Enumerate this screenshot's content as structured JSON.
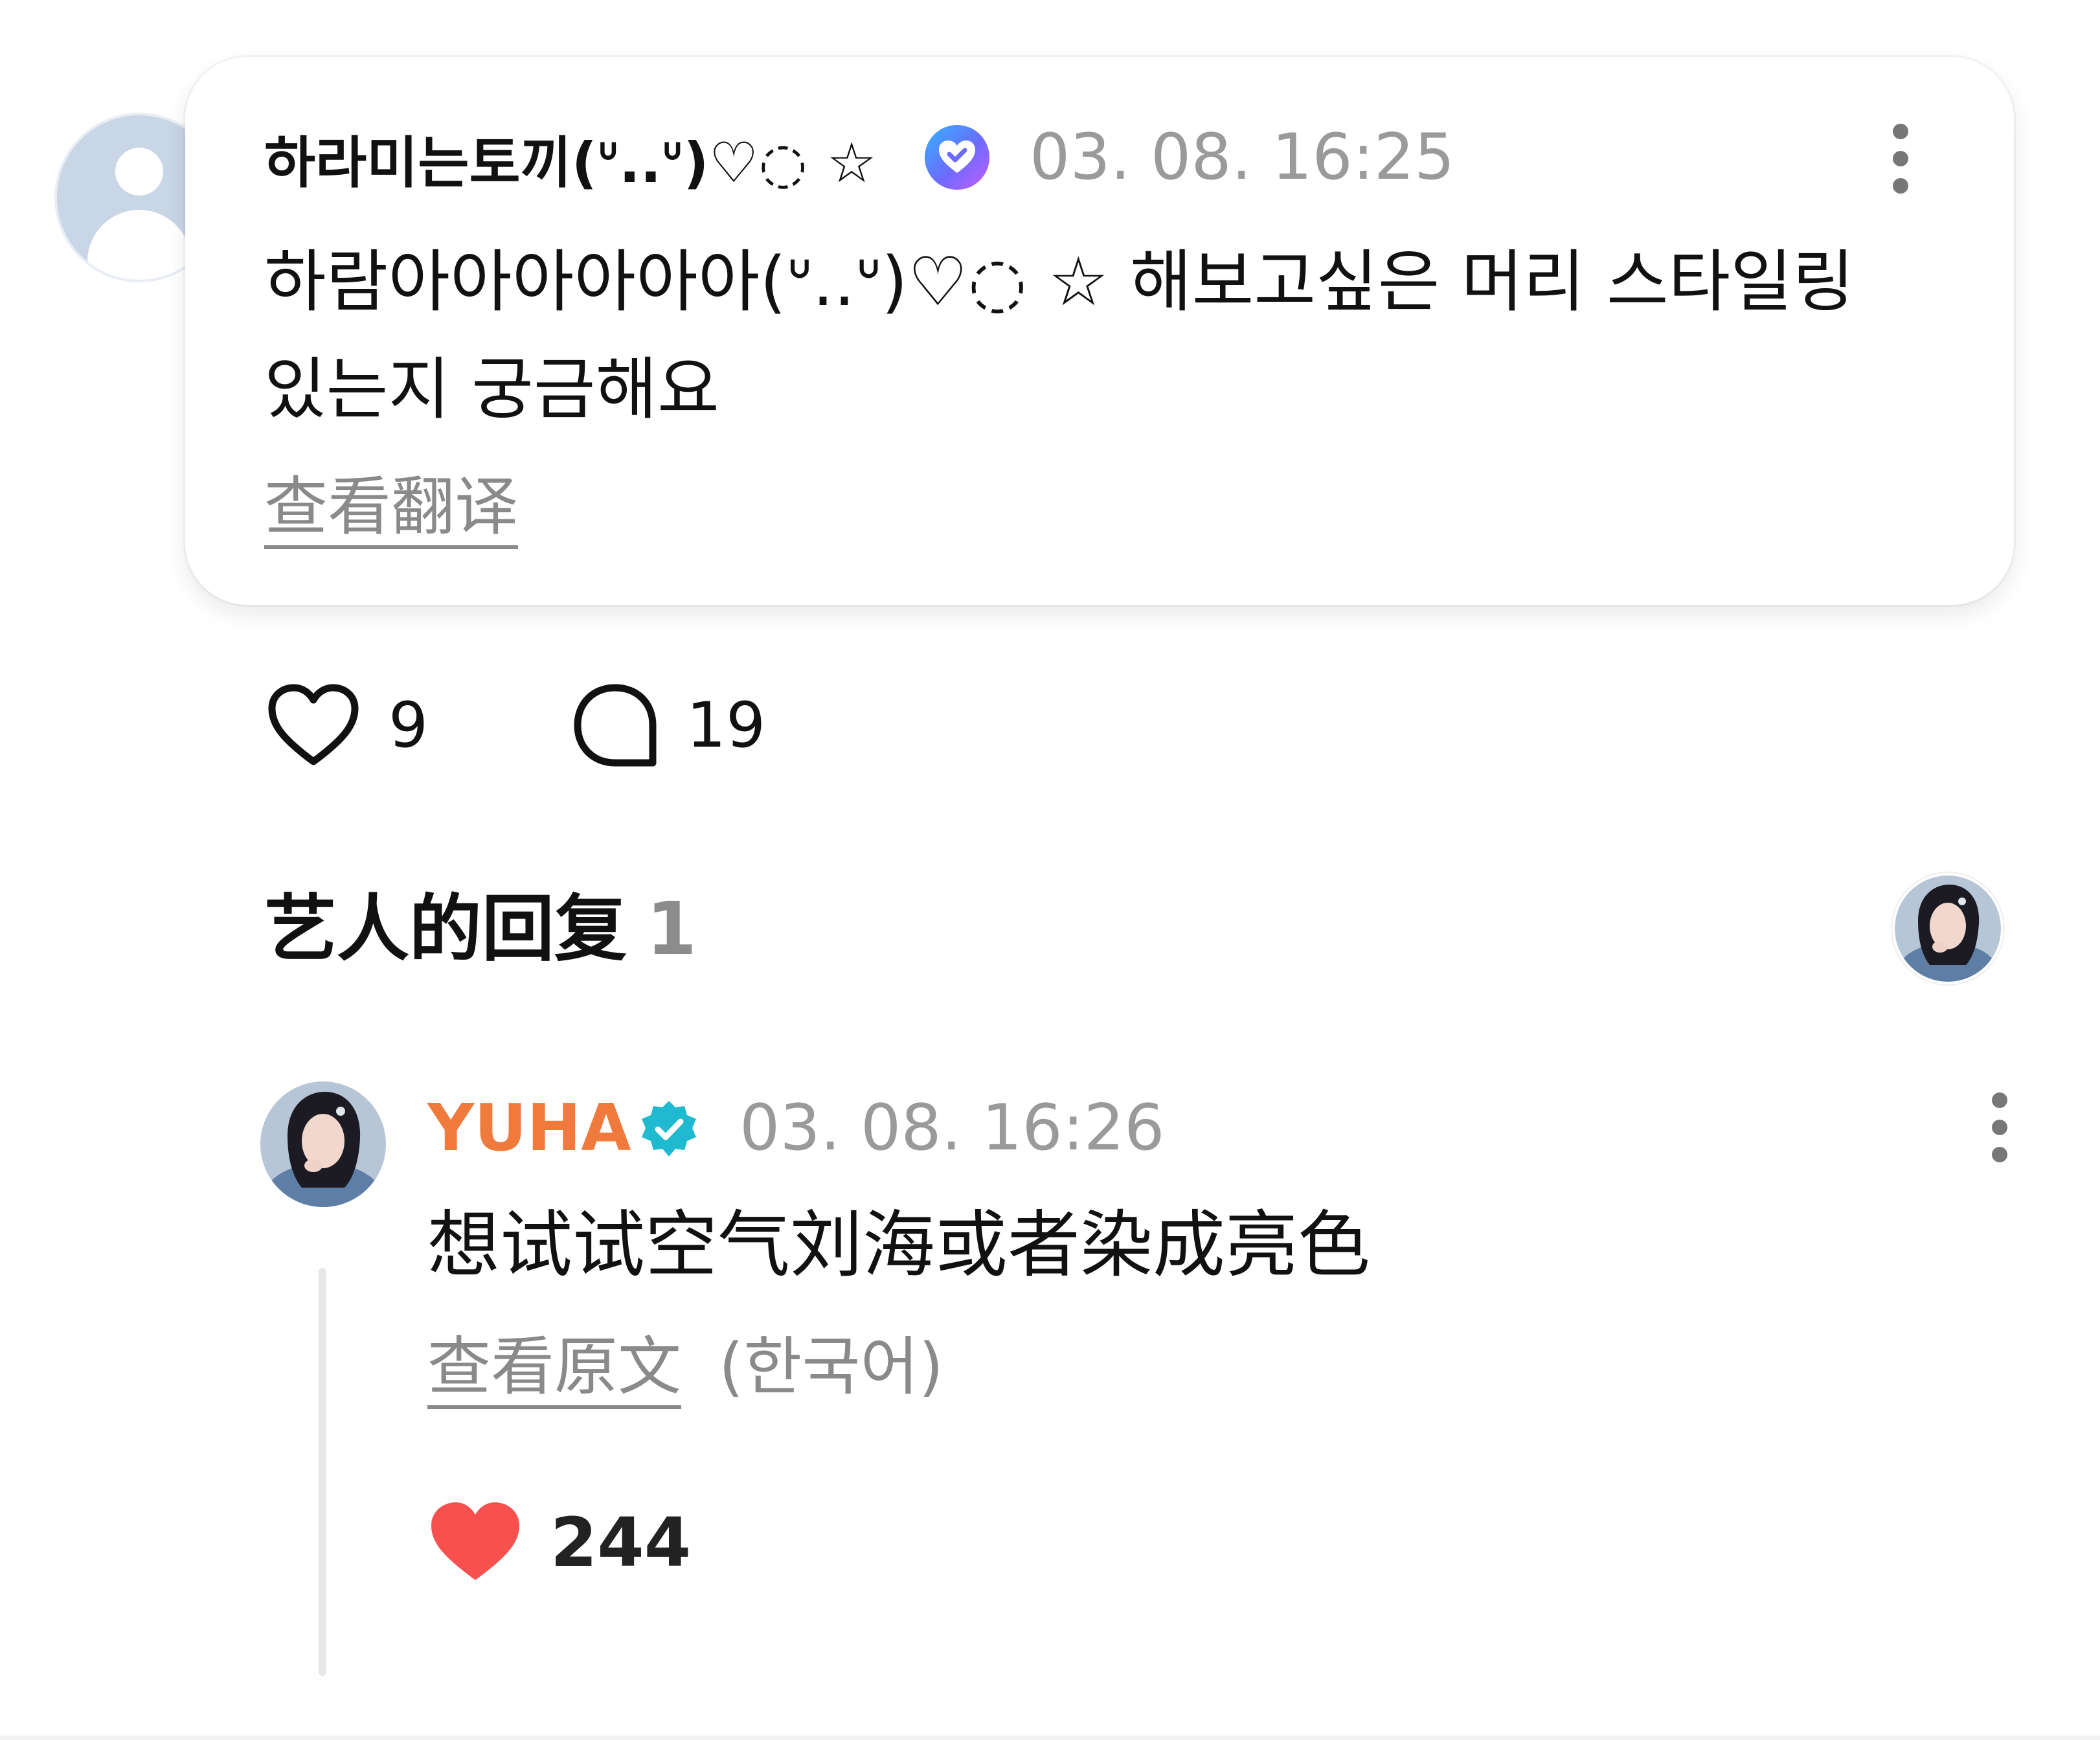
{
  "fan_comment": {
    "author": "하라미는토끼(ᐡ..ᐡ)♡◌ ☆",
    "timestamp": "03. 08. 16:25",
    "text": "하람아아아아아아(ᐡ..ᐡ)♡◌ ☆ 해보고싶은 머리 스타일링 있는지 궁금해요",
    "translate_label": "查看翻译",
    "likes": "9",
    "replies": "19"
  },
  "artist_section": {
    "title": "艺人的回复",
    "count": "1"
  },
  "artist_comment": {
    "name": "YUHA",
    "timestamp": "03. 08. 16:26",
    "text": "想试试空气刘海或者染成亮色",
    "original_label": "查看原文",
    "original_language": "(한국어)",
    "likes": "244"
  },
  "icons": {
    "fan_badge": "heart-check-badge-icon",
    "artist_badge": "verified-icon",
    "like": "heart-outline-icon",
    "reply": "speech-bubble-icon",
    "liked": "heart-filled-icon",
    "more": "more-vertical-icon"
  },
  "colors": {
    "artist_name": "#f07a3c",
    "verified": "#1fbad0",
    "liked_heart": "#f8504f",
    "timestamp": "#9a9a9a"
  }
}
